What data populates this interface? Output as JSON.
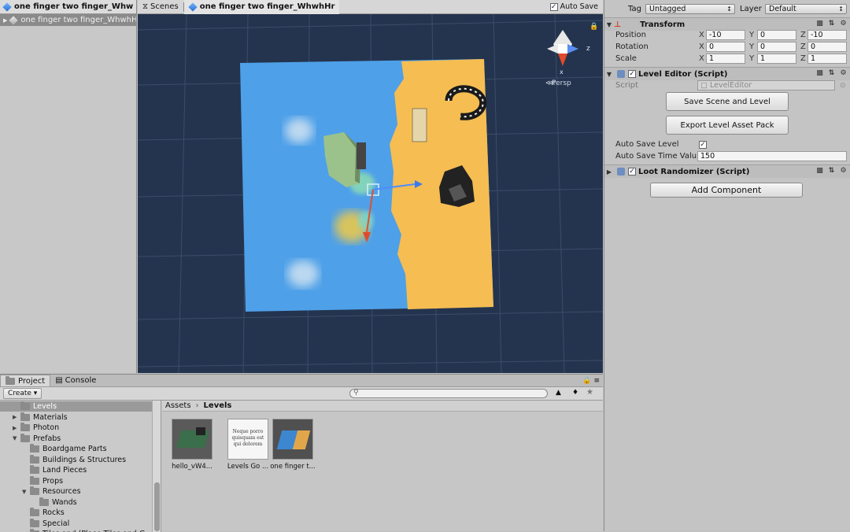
{
  "hierarchy": {
    "tab_title": "one finger two finger_Whw",
    "scene_row": "one finger two finger_WhwhHr"
  },
  "scene": {
    "scenes_label": "Scenes",
    "breadcrumb_scene": "one finger two finger_WhwhHr",
    "auto_save_label": "Auto Save",
    "auto_save_checked": true,
    "gizmo_axis_z": "z",
    "gizmo_axis_x": "x",
    "projection_label": "Persp"
  },
  "inspector": {
    "tag_label": "Tag",
    "tag_value": "Untagged",
    "layer_label": "Layer",
    "layer_value": "Default",
    "transform": {
      "title": "Transform",
      "position_label": "Position",
      "rotation_label": "Rotation",
      "scale_label": "Scale",
      "axis_labels": [
        "X",
        "Y",
        "Z"
      ],
      "position": [
        "-10",
        "0",
        "-10"
      ],
      "rotation": [
        "0",
        "0",
        "0"
      ],
      "scale": [
        "1",
        "1",
        "1"
      ]
    },
    "level_editor": {
      "title": "Level Editor (Script)",
      "script_label": "Script",
      "script_value": "LevelEditor",
      "save_button": "Save Scene and Level",
      "export_button": "Export Level Asset Pack",
      "auto_save_level_label": "Auto Save Level",
      "auto_save_time_label": "Auto Save Time Valu",
      "auto_save_time_value": "150"
    },
    "loot_randomizer": {
      "title": "Loot Randomizer (Script)"
    },
    "add_component_button": "Add Component"
  },
  "project": {
    "tab_project": "Project",
    "tab_console": "Console",
    "create_label": "Create ▾",
    "search_placeholder": "",
    "tree": [
      {
        "label": "Levels",
        "indent": 0,
        "arrow": "",
        "selected": true
      },
      {
        "label": "Materials",
        "indent": 0,
        "arrow": "▶"
      },
      {
        "label": "Photon",
        "indent": 0,
        "arrow": "▶"
      },
      {
        "label": "Prefabs",
        "indent": 0,
        "arrow": "▼"
      },
      {
        "label": "Boardgame Parts",
        "indent": 1,
        "arrow": ""
      },
      {
        "label": "Buildings & Structures",
        "indent": 1,
        "arrow": ""
      },
      {
        "label": "Land Pieces",
        "indent": 1,
        "arrow": ""
      },
      {
        "label": "Props",
        "indent": 1,
        "arrow": ""
      },
      {
        "label": "Resources",
        "indent": 1,
        "arrow": "▼"
      },
      {
        "label": "Wands",
        "indent": 2,
        "arrow": ""
      },
      {
        "label": "Rocks",
        "indent": 1,
        "arrow": ""
      },
      {
        "label": "Special",
        "indent": 1,
        "arrow": ""
      },
      {
        "label": "Tiles and (Place Tiles and G",
        "indent": 1,
        "arrow": ""
      }
    ],
    "breadcrumb_root": "Assets",
    "breadcrumb_current": "Levels",
    "assets": [
      {
        "label": "hello_vW4...",
        "kind": "scene-thumb"
      },
      {
        "label": "Levels Go ...",
        "kind": "text-file",
        "preview": "Neque porro quisquam est qui dolorem"
      },
      {
        "label": "one finger t...",
        "kind": "scene-thumb-2"
      }
    ]
  }
}
